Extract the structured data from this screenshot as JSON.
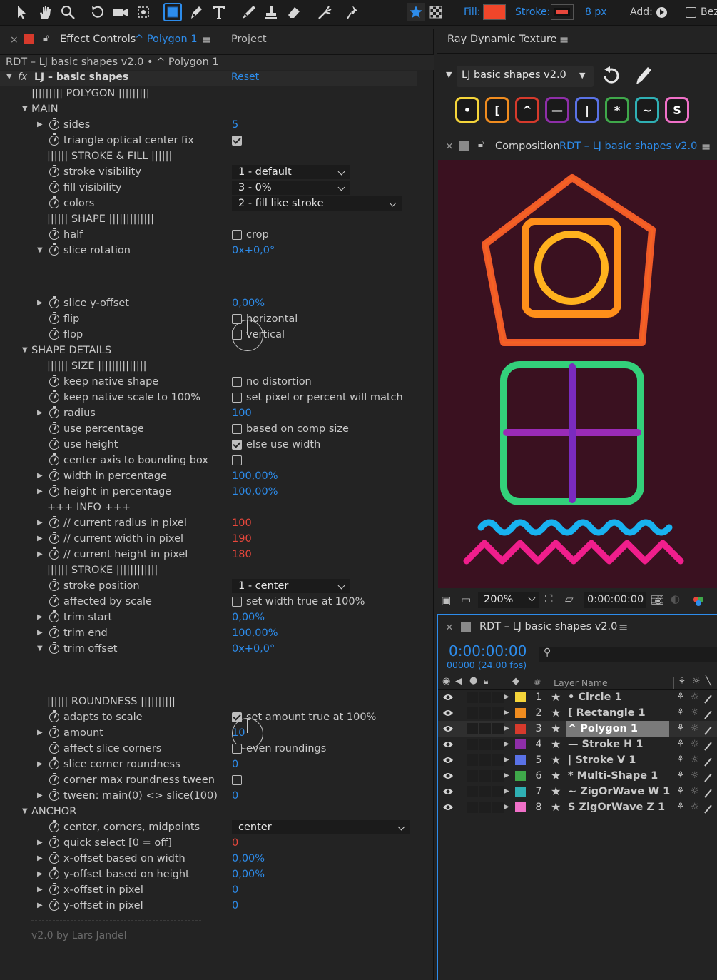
{
  "toolbar": {
    "fill_label": "Fill:",
    "stroke_label": "Stroke:",
    "stroke_width": "8 px",
    "add_label": "Add:",
    "bezier_label": "Bez",
    "fill_color": "#f0462a",
    "stroke_color": "#e8473c"
  },
  "effect_panel": {
    "tab_label": "Effect Controls",
    "tab_layer": "^ Polygon 1",
    "tab_project": "Project",
    "breadcrumb": "RDT – LJ basic shapes v2.0 • ^ Polygon 1",
    "effect_name": "LJ – basic shapes",
    "reset": "Reset",
    "footer": "v2.0 by Lars Jandel",
    "rows": [
      {
        "type": "text",
        "indent": 44,
        "label": "||||||||| POLYGON |||||||||"
      },
      {
        "type": "group",
        "label": "MAIN"
      },
      {
        "type": "prop",
        "arrow": true,
        "label": "sides",
        "value": "5"
      },
      {
        "type": "prop",
        "label": "triangle optical center fix",
        "checkbox": true,
        "checked": true
      },
      {
        "type": "text",
        "indent": 66,
        "label": "|||||| STROKE & FILL ||||||"
      },
      {
        "type": "prop",
        "label": "stroke visibility",
        "dropdown": "1 - default",
        "ddw": 166
      },
      {
        "type": "prop",
        "label": "fill visibility",
        "dropdown": "3 - 0%",
        "ddw": 166
      },
      {
        "type": "prop",
        "label": "colors",
        "dropdown": "2 - fill like stroke",
        "ddw": 238
      },
      {
        "type": "text",
        "indent": 66,
        "label": "|||||| SHAPE |||||||||||||"
      },
      {
        "type": "prop",
        "label": "half",
        "checkbox": true,
        "checked": false,
        "cblabel": "crop"
      },
      {
        "type": "prop",
        "open": true,
        "label": "slice rotation",
        "value": "0x+0,0°"
      },
      {
        "type": "dial",
        "height": 52
      },
      {
        "type": "prop",
        "arrow": true,
        "label": "slice y-offset",
        "value": "0,00%"
      },
      {
        "type": "prop",
        "label": "flip",
        "checkbox": true,
        "checked": false,
        "cblabel": "horizontal"
      },
      {
        "type": "prop",
        "label": "flop",
        "checkbox": true,
        "checked": false,
        "cblabel": "vertical"
      },
      {
        "type": "group",
        "label": "SHAPE DETAILS"
      },
      {
        "type": "text",
        "indent": 66,
        "label": "|||||| SIZE ||||||||||||||"
      },
      {
        "type": "prop",
        "label": "keep native shape",
        "checkbox": true,
        "checked": false,
        "cblabel": "no distortion"
      },
      {
        "type": "prop",
        "label": "keep native scale to 100%",
        "checkbox": true,
        "checked": false,
        "cblabel": "set pixel or percent will match"
      },
      {
        "type": "prop",
        "arrow": true,
        "label": "radius",
        "value": "100"
      },
      {
        "type": "prop",
        "label": "use percentage",
        "checkbox": true,
        "checked": false,
        "cblabel": "based on comp size"
      },
      {
        "type": "prop",
        "label": "use height",
        "checkbox": true,
        "checked": true,
        "cblabel": "else use width"
      },
      {
        "type": "prop",
        "label": "center axis to bounding box",
        "checkbox": true,
        "checked": false
      },
      {
        "type": "prop",
        "arrow": true,
        "label": "width in percentage",
        "value": "100,00%"
      },
      {
        "type": "prop",
        "arrow": true,
        "label": "height in percentage",
        "value": "100,00%"
      },
      {
        "type": "text",
        "indent": 66,
        "label": "+++ INFO +++"
      },
      {
        "type": "prop",
        "arrow": true,
        "label": "// current radius in pixel",
        "value": "100",
        "red": true
      },
      {
        "type": "prop",
        "arrow": true,
        "label": "// current width in pixel",
        "value": "190",
        "red": true
      },
      {
        "type": "prop",
        "arrow": true,
        "label": "// current height in pixel",
        "value": "180",
        "red": true
      },
      {
        "type": "text",
        "indent": 66,
        "label": "|||||| STROKE ||||||||||||"
      },
      {
        "type": "prop",
        "label": "stroke position",
        "dropdown": "1 - center",
        "ddw": 166
      },
      {
        "type": "prop",
        "label": "affected by scale",
        "checkbox": true,
        "checked": false,
        "cblabel": "set width true at 100%"
      },
      {
        "type": "prop",
        "arrow": true,
        "label": "trim start",
        "value": "0,00%"
      },
      {
        "type": "prop",
        "arrow": true,
        "label": "trim end",
        "value": "100,00%"
      },
      {
        "type": "prop",
        "open": true,
        "label": "trim offset",
        "value": "0x+0,0°"
      },
      {
        "type": "dial",
        "height": 52
      },
      {
        "type": "text",
        "indent": 66,
        "label": "|||||| ROUNDNESS ||||||||||"
      },
      {
        "type": "prop",
        "label": "adapts to scale",
        "checkbox": true,
        "checked": true,
        "cblabel": "set amount true at 100%"
      },
      {
        "type": "prop",
        "arrow": true,
        "label": "amount",
        "value": "10"
      },
      {
        "type": "prop",
        "label": "affect slice corners",
        "checkbox": true,
        "checked": false,
        "cblabel": "even roundings"
      },
      {
        "type": "prop",
        "arrow": true,
        "label": "slice corner roundness",
        "value": "0"
      },
      {
        "type": "prop",
        "label": "corner max roundness tween",
        "checkbox": true,
        "checked": false
      },
      {
        "type": "prop",
        "arrow": true,
        "label": "tween: main(0) <> slice(100)",
        "value": "0"
      },
      {
        "type": "group",
        "label": "ANCHOR"
      },
      {
        "type": "prop",
        "label": "center, corners, midpoints",
        "dropdown": "center",
        "ddw": 250
      },
      {
        "type": "prop",
        "arrow": true,
        "label": "quick select [0 = off]",
        "value": "0",
        "red": true
      },
      {
        "type": "prop",
        "arrow": true,
        "label": "x-offset based on width",
        "value": "0,00%"
      },
      {
        "type": "prop",
        "arrow": true,
        "label": "y-offset based on height",
        "value": "0,00%"
      },
      {
        "type": "prop",
        "arrow": true,
        "label": "x-offset in pixel",
        "value": "0"
      },
      {
        "type": "prop",
        "arrow": true,
        "label": "y-offset in pixel",
        "value": "0"
      }
    ]
  },
  "rdt_panel": {
    "title": "Ray Dynamic Texture",
    "preset": "LJ basic shapes v2.0",
    "buttons": [
      {
        "label": "•",
        "color": "#f5d53a"
      },
      {
        "label": "[",
        "color": "#f08c1f"
      },
      {
        "label": "^",
        "color": "#d63a2c"
      },
      {
        "label": "—",
        "color": "#8e2ea8"
      },
      {
        "label": "|",
        "color": "#5a72e6"
      },
      {
        "label": "*",
        "color": "#3fa84a"
      },
      {
        "label": "~",
        "color": "#2fb0b4"
      },
      {
        "label": "S",
        "color": "#f070c8"
      }
    ]
  },
  "composition": {
    "tab_prefix": "Composition",
    "tab_name": "RDT – LJ basic shapes v2.0",
    "zoom": "200%",
    "timecode": "0:00:00:00",
    "bg_color": "#3a1120"
  },
  "timeline": {
    "title": "RDT – LJ basic shapes v2.0",
    "time": "0:00:00:00",
    "frames": "00000 (24.00 fps)",
    "col_hash": "#",
    "col_layer_name": "Layer Name",
    "layers": [
      {
        "num": "1",
        "name": "• Circle 1",
        "color": "#f5d53a"
      },
      {
        "num": "2",
        "name": "[ Rectangle 1",
        "color": "#f08c1f"
      },
      {
        "num": "3",
        "name": "^ Polygon 1",
        "color": "#d63a2c",
        "selected": true
      },
      {
        "num": "4",
        "name": "— Stroke H 1",
        "color": "#8e2ea8"
      },
      {
        "num": "5",
        "name": "| Stroke V 1",
        "color": "#5a72e6"
      },
      {
        "num": "6",
        "name": "* Multi-Shape 1",
        "color": "#3fa84a"
      },
      {
        "num": "7",
        "name": "~ ZigOrWave W 1",
        "color": "#2fb0b4"
      },
      {
        "num": "8",
        "name": "S ZigOrWave Z 1",
        "color": "#f070c8"
      }
    ]
  }
}
